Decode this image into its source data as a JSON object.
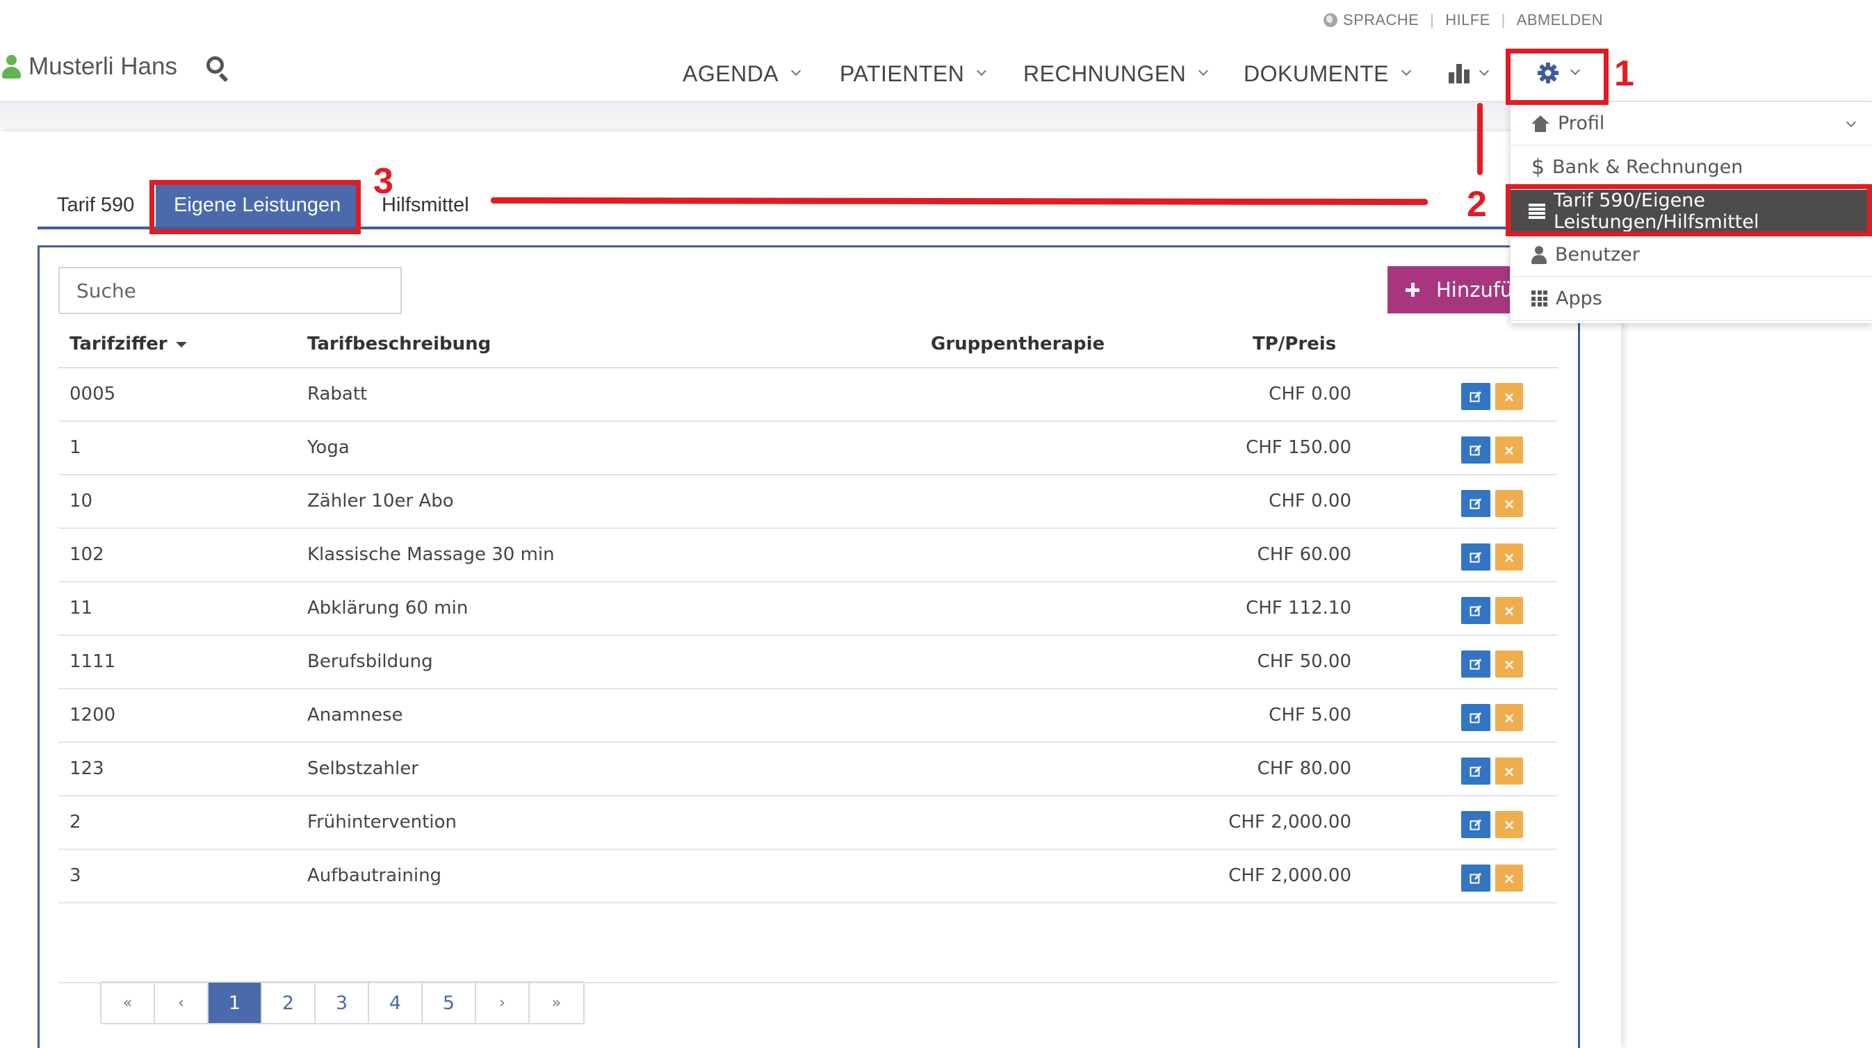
{
  "topbar": {
    "utility": {
      "language": "SPRACHE",
      "help": "HILFE",
      "logout": "ABMELDEN"
    },
    "user_name": "Musterli Hans",
    "nav": [
      {
        "label": "AGENDA"
      },
      {
        "label": "PATIENTEN"
      },
      {
        "label": "RECHNUNGEN"
      },
      {
        "label": "DOKUMENTE"
      }
    ]
  },
  "settings_menu": {
    "items": [
      {
        "label": "Profil",
        "icon": "home-icon"
      },
      {
        "label": "Bank & Rechnungen",
        "icon": "dollar-icon"
      },
      {
        "label": "Tarif 590/Eigene Leistungen/Hilfsmittel",
        "icon": "list-icon",
        "selected": true
      },
      {
        "label": "Benutzer",
        "icon": "person-icon"
      },
      {
        "label": "Apps",
        "icon": "grid-icon"
      }
    ]
  },
  "annotations": {
    "step1": "1",
    "step2": "2",
    "step3": "3"
  },
  "tabs": [
    {
      "label": "Tarif 590"
    },
    {
      "label": "Eigene Leistungen",
      "active": true
    },
    {
      "label": "Hilfsmittel"
    }
  ],
  "search": {
    "placeholder": "Suche"
  },
  "add_button": {
    "label": "Hinzufügen"
  },
  "table": {
    "columns": {
      "code": "Tarifziffer",
      "description": "Tarifbeschreibung",
      "group": "Gruppentherapie",
      "price": "TP/Preis"
    },
    "rows": [
      {
        "code": "0005",
        "description": "Rabatt",
        "price": "CHF 0.00"
      },
      {
        "code": "1",
        "description": "Yoga",
        "price": "CHF 150.00"
      },
      {
        "code": "10",
        "description": "Zähler 10er Abo",
        "price": "CHF 0.00"
      },
      {
        "code": "102",
        "description": "Klassische Massage 30 min",
        "price": "CHF 60.00"
      },
      {
        "code": "11",
        "description": "Abklärung 60 min",
        "price": "CHF 112.10"
      },
      {
        "code": "1111",
        "description": "Berufsbildung",
        "price": "CHF 50.00"
      },
      {
        "code": "1200",
        "description": "Anamnese",
        "price": "CHF 5.00"
      },
      {
        "code": "123",
        "description": "Selbstzahler",
        "price": "CHF 80.00"
      },
      {
        "code": "2",
        "description": "Frühintervention",
        "price": "CHF 2,000.00"
      },
      {
        "code": "3",
        "description": "Aufbautraining",
        "price": "CHF 2,000.00"
      }
    ]
  },
  "pagination": {
    "first": "«",
    "prev": "‹",
    "next": "›",
    "last": "»",
    "pages": [
      "1",
      "2",
      "3",
      "4",
      "5"
    ],
    "current": "1"
  },
  "colors": {
    "primary": "#4a6aab",
    "add_button": "#a8367f",
    "edit": "#3275c2",
    "delete": "#f0ad4e",
    "annotation": "#e21b23",
    "user_icon": "#63b54f",
    "menu_selected": "#4c4c4c"
  }
}
